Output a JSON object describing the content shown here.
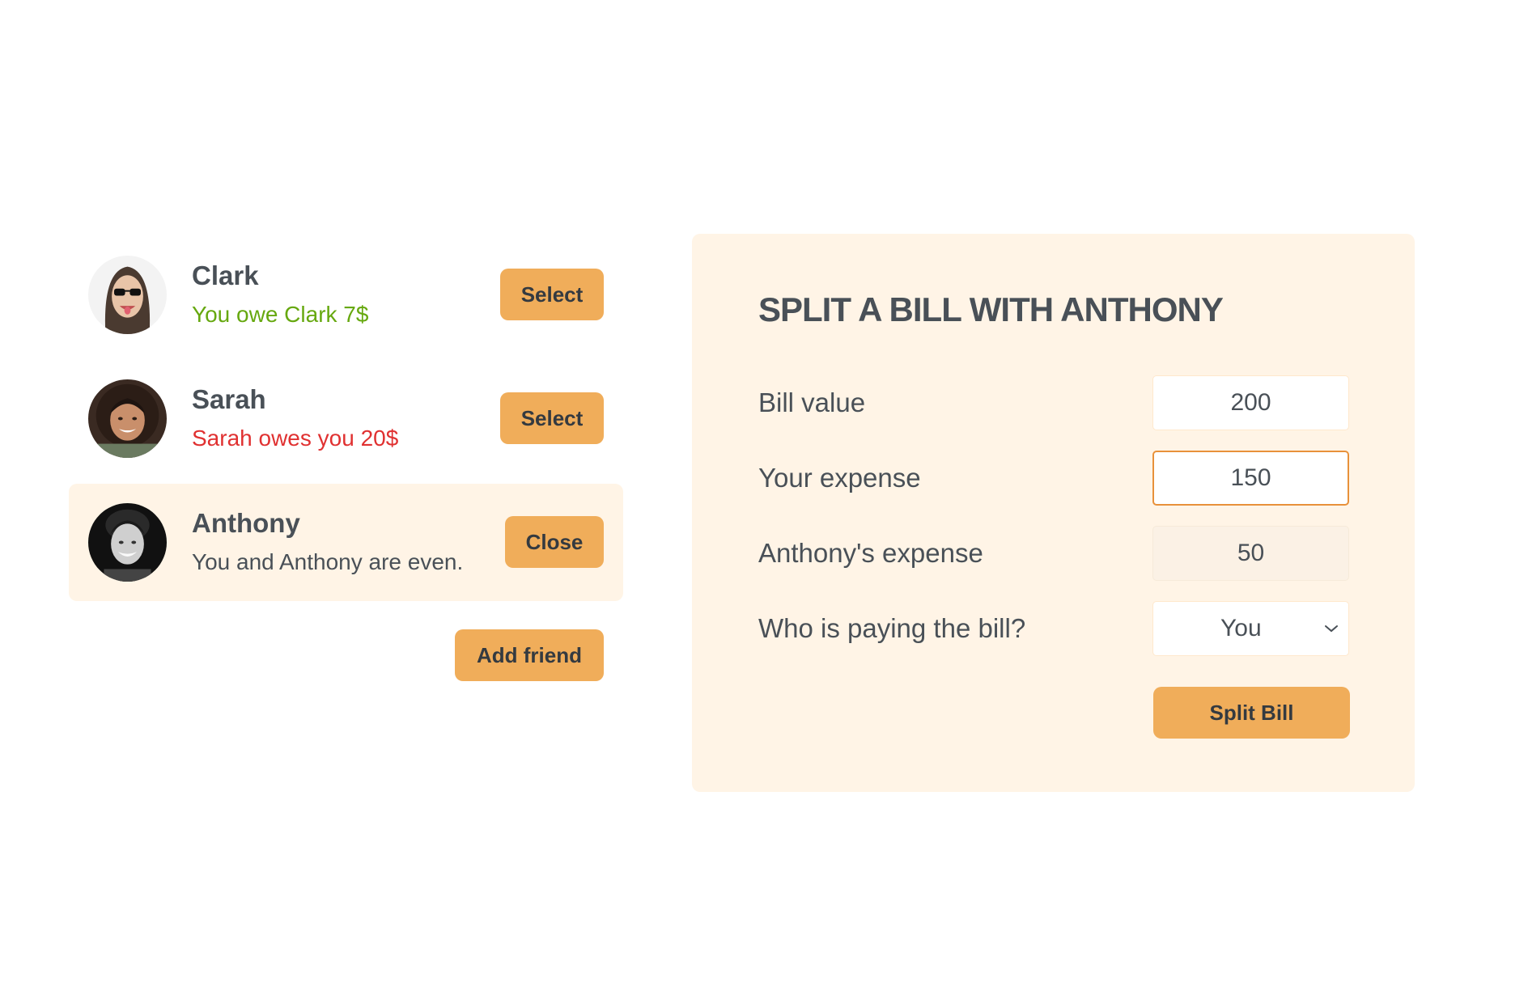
{
  "friends": [
    {
      "name": "Clark",
      "status": "You owe Clark 7$",
      "status_tone": "green",
      "button_label": "Select",
      "selected": false,
      "avatar_icon": "clark-avatar"
    },
    {
      "name": "Sarah",
      "status": "Sarah owes you 20$",
      "status_tone": "red",
      "button_label": "Select",
      "selected": false,
      "avatar_icon": "sarah-avatar"
    },
    {
      "name": "Anthony",
      "status": "You and Anthony are even.",
      "status_tone": "grey",
      "button_label": "Close",
      "selected": true,
      "avatar_icon": "anthony-avatar"
    }
  ],
  "add_friend_label": "Add friend",
  "form": {
    "title": "SPLIT A BILL WITH ANTHONY",
    "bill_value_label": "Bill value",
    "bill_value": "200",
    "your_expense_label": "Your expense",
    "your_expense": "150",
    "friend_expense_label": "Anthony's expense",
    "friend_expense": "50",
    "payer_label": "Who is paying the bill?",
    "payer_value": "You",
    "submit_label": "Split Bill"
  },
  "colors": {
    "accent": "#f0ad5a",
    "panel_bg": "#fff4e6",
    "owe_green": "#66a80f",
    "owed_red": "#e03131",
    "text": "#495057",
    "focus_border": "#e8913a"
  }
}
